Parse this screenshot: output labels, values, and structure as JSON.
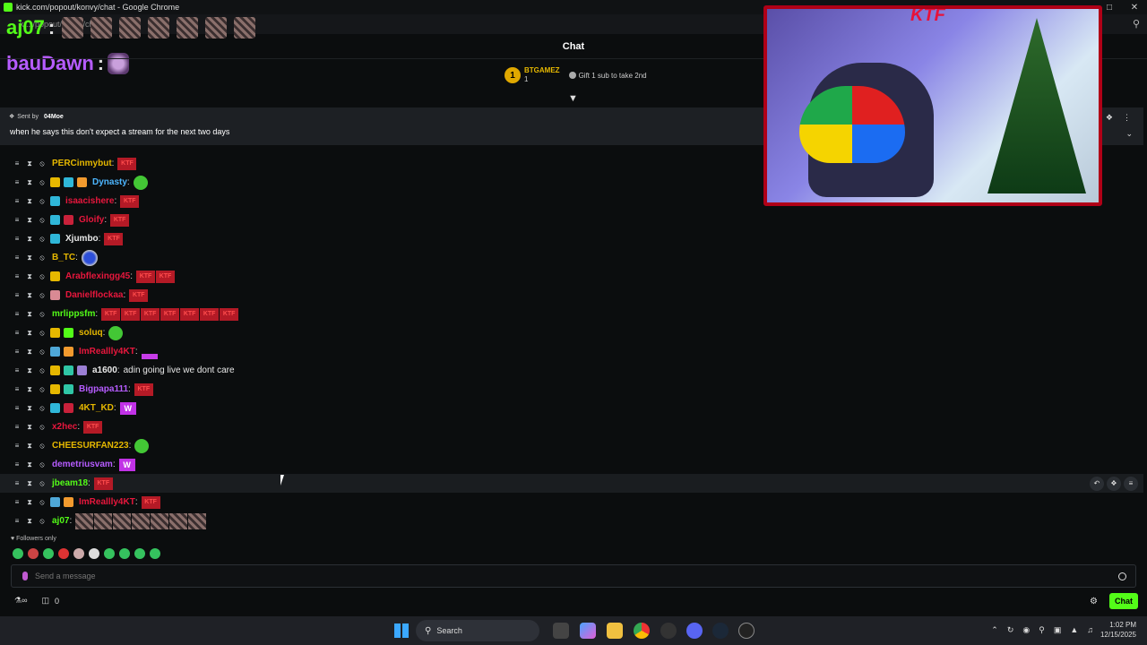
{
  "browser": {
    "title": "kick.com/popout/konvy/chat - Google Chrome",
    "url_partial": "k... /popout/konvy/ch..."
  },
  "overlay": {
    "line1_user": "aj07",
    "line2_user": "bauDawn",
    "colon": ":"
  },
  "chat": {
    "header": "Chat",
    "top_gifter": {
      "rank": "1",
      "name": "BTGAMEZ",
      "count": "1"
    },
    "gift_prompt": "Gift 1 sub to take 2nd",
    "partial_top_row": "LIMITED"
  },
  "pinned": {
    "sent_by_label": "Sent by",
    "sender": "04Moe",
    "text": "when he says this don't expect a stream for the next two days"
  },
  "messages": [
    {
      "user": "PERCinmybut",
      "color": "#e6b800",
      "badges": [],
      "emotes": [
        "ktf"
      ],
      "text": ""
    },
    {
      "user": "Dynasty",
      "color": "#4db6ff",
      "badges": [
        "crown",
        "gift",
        "shirt"
      ],
      "emotes": [
        "fd"
      ],
      "text": ""
    },
    {
      "user": "isaacishere",
      "color": "#e8173d",
      "badges": [
        "gift"
      ],
      "emotes": [
        "ktf"
      ],
      "text": ""
    },
    {
      "user": "Gloify",
      "color": "#e8173d",
      "badges": [
        "gift",
        "bear"
      ],
      "emotes": [
        "ktf"
      ],
      "text": ""
    },
    {
      "user": "Xjumbo",
      "color": "#e8e8e8",
      "badges": [
        "gift"
      ],
      "emotes": [
        "ktf"
      ],
      "text": ""
    },
    {
      "user": "B_TC",
      "color": "#e6b800",
      "badges": [],
      "emotes": [
        "robot"
      ],
      "text": ""
    },
    {
      "user": "Arabflexingg45",
      "color": "#e8173d",
      "badges": [
        "crown"
      ],
      "emotes": [
        "ktf",
        "ktf"
      ],
      "text": ""
    },
    {
      "user": "Danielflockaa",
      "color": "#e8173d",
      "badges": [
        "shirt2"
      ],
      "emotes": [
        "ktf"
      ],
      "text": ""
    },
    {
      "user": "mrlippsfm",
      "color": "#53fc18",
      "badges": [],
      "emotes": [
        "ktf",
        "ktf",
        "ktf",
        "ktf",
        "ktf",
        "ktf",
        "ktf"
      ],
      "text": ""
    },
    {
      "user": "soluq",
      "color": "#e6b800",
      "badges": [
        "crown",
        "green"
      ],
      "emotes": [
        "fd"
      ],
      "text": ""
    },
    {
      "user": "ImReallly4KT",
      "color": "#e8173d",
      "badges": [
        "axe",
        "shirt"
      ],
      "emotes": [
        "pbox"
      ],
      "text": ""
    },
    {
      "user": "a1600",
      "color": "#e8e8e8",
      "badges": [
        "crown",
        "shirt3",
        "robe"
      ],
      "emotes": [],
      "text": "adin going live we dont care"
    },
    {
      "user": "Bigpapa111",
      "color": "#b65cff",
      "badges": [
        "crown",
        "shirt3"
      ],
      "emotes": [
        "ktf"
      ],
      "text": ""
    },
    {
      "user": "4KT_KD",
      "color": "#e6b800",
      "badges": [
        "gift",
        "bear"
      ],
      "emotes": [
        "w"
      ],
      "text": ""
    },
    {
      "user": "x2hec",
      "color": "#e8173d",
      "badges": [],
      "emotes": [
        "ktf"
      ],
      "text": ""
    },
    {
      "user": "CHEESURFAN223",
      "color": "#e6b800",
      "badges": [],
      "emotes": [
        "fd"
      ],
      "text": ""
    },
    {
      "user": "demetriusvam",
      "color": "#b65cff",
      "badges": [],
      "emotes": [
        "w"
      ],
      "text": ""
    },
    {
      "user": "jbeam18",
      "color": "#53fc18",
      "badges": [],
      "emotes": [
        "ktf"
      ],
      "text": "",
      "highlight": true
    },
    {
      "user": "ImReallly4KT",
      "color": "#e8173d",
      "badges": [
        "axe",
        "shirt"
      ],
      "emotes": [
        "ktf"
      ],
      "text": ""
    },
    {
      "user": "aj07",
      "color": "#53fc18",
      "badges": [],
      "emotes": [
        "glitch",
        "glitch",
        "glitch",
        "glitch",
        "glitch",
        "glitch",
        "glitch"
      ],
      "text": ""
    }
  ],
  "footer": {
    "followers_only": "Followers only",
    "input_placeholder": "Send a message",
    "points": "0",
    "chat_button": "Chat"
  },
  "taskbar": {
    "search_label": "Search",
    "time": "1:02 PM",
    "date": "12/15/2025"
  },
  "overlay_logo": "KTF"
}
